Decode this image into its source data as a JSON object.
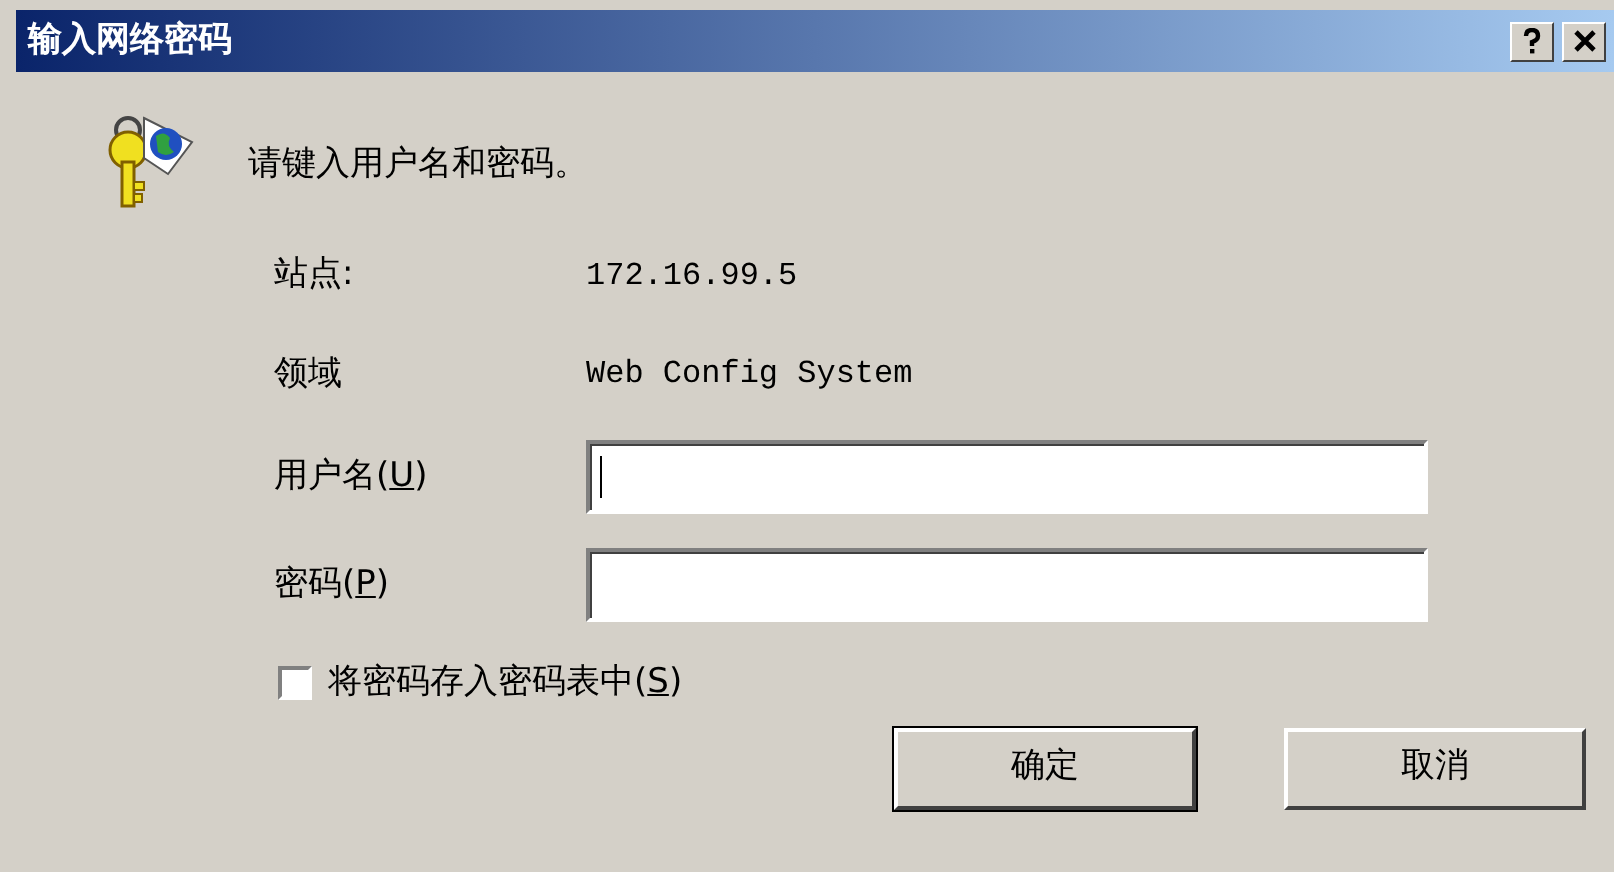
{
  "window": {
    "title": "输入网络密码",
    "title_buttons": [
      {
        "kind": "help"
      },
      {
        "kind": "close"
      }
    ]
  },
  "message": "请键入用户名和密码。",
  "info": [
    {
      "label": "站点:",
      "value": "172.16.99.5"
    },
    {
      "label": "领域",
      "value": "Web Config System"
    }
  ],
  "fields": [
    {
      "label_before": "用户名(",
      "access_key": "U",
      "label_after": ")",
      "focused": true
    },
    {
      "label_before": "密码(",
      "access_key": "P",
      "label_after": ")",
      "focused": false
    }
  ],
  "save_password": {
    "label_before": "将密码存入密码表中(",
    "access_key": "S",
    "label_after": ")",
    "checked": false
  },
  "buttons": [
    {
      "label": "确定",
      "default": true
    },
    {
      "label": "取消",
      "default": false
    }
  ]
}
